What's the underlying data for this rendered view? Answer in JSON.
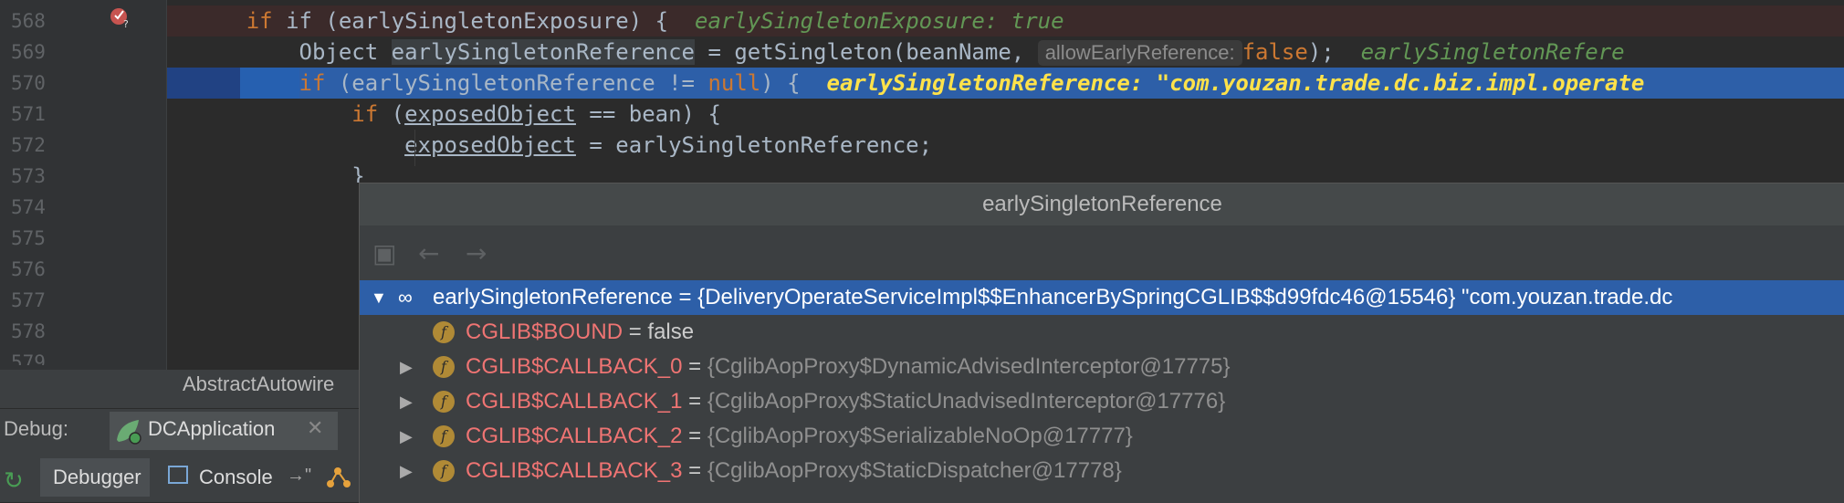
{
  "editor": {
    "line_numbers": [
      "568",
      "569",
      "570",
      "571",
      "572",
      "573",
      "574",
      "575",
      "576",
      "577",
      "578",
      "579"
    ],
    "line568": {
      "code": "if (earlySingletonExposure) {",
      "hint": "earlySingletonExposure: true"
    },
    "line569": {
      "code_prefix": "Object ",
      "var": "earlySingletonReference",
      "code_mid": " = getSingleton(beanName, ",
      "param_label": "allowEarlyReference:",
      "param_value": "false",
      "code_suffix": ");",
      "hint": "earlySingletonRefere"
    },
    "line570": {
      "kw": "if",
      "code": " (earlySingletonReference != ",
      "null": "null",
      "code_end": ") {",
      "hint": "earlySingletonReference: \"com.youzan.trade.dc.biz.impl.operate"
    },
    "line571": {
      "kw": "if",
      "open": " (",
      "var": "exposedObject",
      "rest": " == bean) {"
    },
    "line572": {
      "var": "exposedObject",
      "rest": " = earlySingletonReference;"
    },
    "line573": {
      "code": "}"
    }
  },
  "bottom": {
    "file_tab": "AbstractAutowire",
    "debug_label": "Debug:",
    "app_tab": "DCApplication",
    "debugger_tab": "Debugger",
    "console_tab": "Console",
    "console_arrow": "→\""
  },
  "popup": {
    "title": "earlySingletonReference",
    "root": {
      "name": "earlySingletonReference",
      "value": " = {DeliveryOperateServiceImpl$$EnhancerBySpringCGLIB$$d99fdc46@15546} \"com.youzan.trade.dc"
    },
    "fields": [
      {
        "name": "CGLIB$BOUND",
        "eq": " = ",
        "value": "false",
        "expandable": false
      },
      {
        "name": "CGLIB$CALLBACK_0",
        "eq": " = ",
        "value": "{CglibAopProxy$DynamicAdvisedInterceptor@17775}",
        "expandable": true
      },
      {
        "name": "CGLIB$CALLBACK_1",
        "eq": " = ",
        "value": "{CglibAopProxy$StaticUnadvisedInterceptor@17776}",
        "expandable": true
      },
      {
        "name": "CGLIB$CALLBACK_2",
        "eq": " = ",
        "value": "{CglibAopProxy$SerializableNoOp@17777}",
        "expandable": true
      },
      {
        "name": "CGLIB$CALLBACK_3",
        "eq": " = ",
        "value": "{CglibAopProxy$StaticDispatcher@17778}",
        "expandable": true
      }
    ],
    "field_icon": "f"
  },
  "colors": {
    "selection": "#2d5fa8",
    "keyword": "#cc7832",
    "hint": "#629755",
    "field_name": "#ef7473"
  }
}
